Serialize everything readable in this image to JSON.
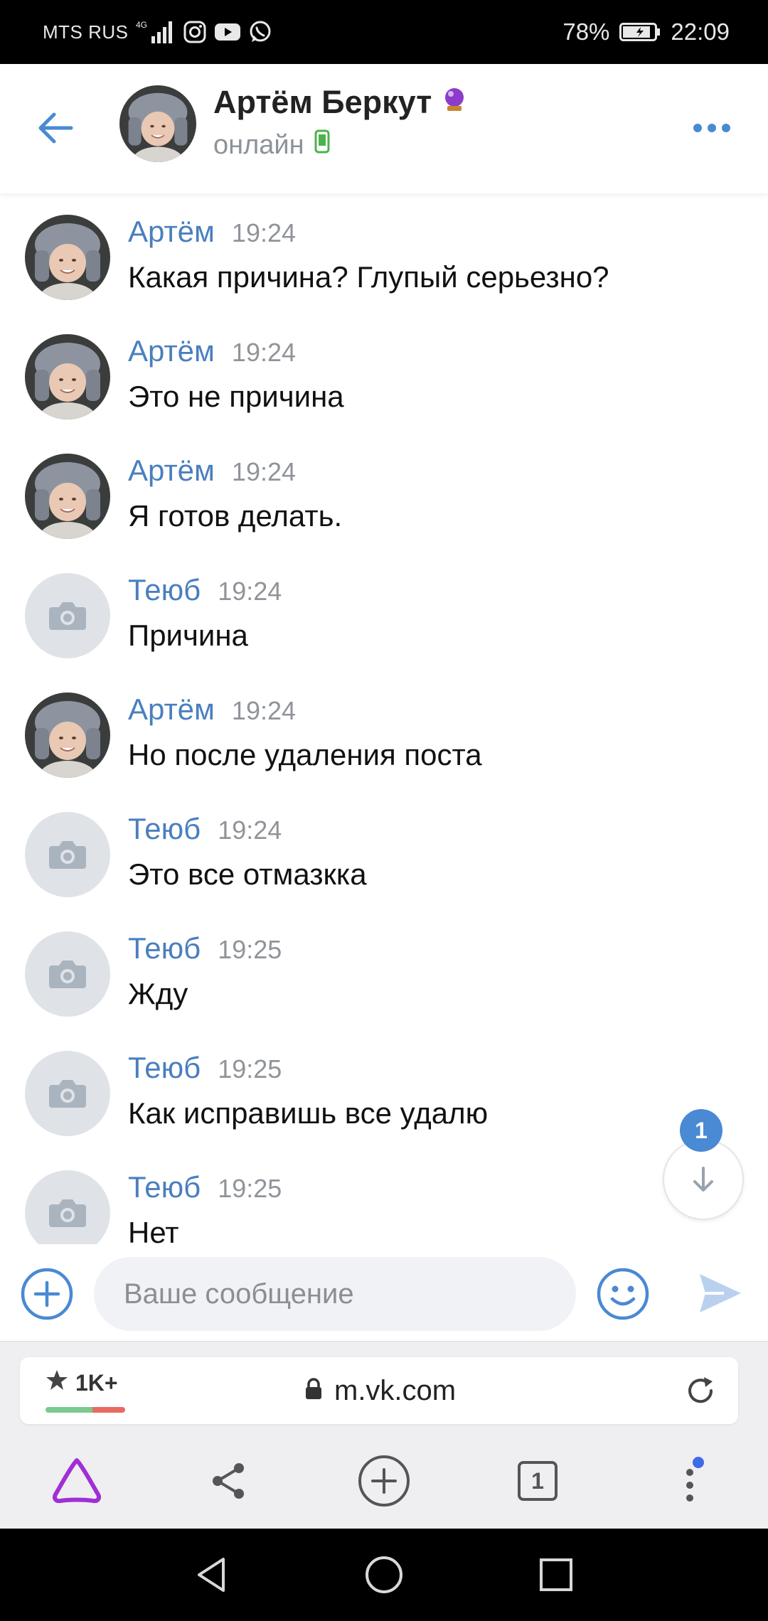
{
  "status_bar": {
    "carrier": "MTS RUS",
    "network": "4G",
    "battery": "78%",
    "time": "22:09"
  },
  "chat_header": {
    "name": "Артём Беркут",
    "status": "онлайн",
    "back_icon": "arrow-left-icon",
    "more_icon": "ellipsis-icon"
  },
  "messages": [
    {
      "author": "Артём",
      "time": "19:24",
      "text": "Какая причина? Глупый серьезно?",
      "avatar": "photo"
    },
    {
      "author": "Артём",
      "time": "19:24",
      "text": "Это не причина",
      "avatar": "photo"
    },
    {
      "author": "Артём",
      "time": "19:24",
      "text": "Я готов делать.",
      "avatar": "photo"
    },
    {
      "author": "Теюб",
      "time": "19:24",
      "text": "Причина",
      "avatar": "placeholder"
    },
    {
      "author": "Артём",
      "time": "19:24",
      "text": "Но после удаления поста",
      "avatar": "photo"
    },
    {
      "author": "Теюб",
      "time": "19:24",
      "text": "Это все отмазкка",
      "avatar": "placeholder"
    },
    {
      "author": "Теюб",
      "time": "19:25",
      "text": "Жду",
      "avatar": "placeholder"
    },
    {
      "author": "Теюб",
      "time": "19:25",
      "text": "Как исправишь все удалю",
      "avatar": "placeholder"
    },
    {
      "author": "Теюб",
      "time": "19:25",
      "text": "Нет",
      "avatar": "placeholder"
    }
  ],
  "scroll_down": {
    "badge": "1"
  },
  "composer": {
    "placeholder": "Ваше сообщение"
  },
  "browser": {
    "rating": "1K+",
    "url": "m.vk.com",
    "tabs_count": "1"
  },
  "colors": {
    "accent": "#4a7fbe",
    "badge": "#4a89d4",
    "alice": "#a02fd6",
    "rating_good": "#7bc98f",
    "rating_bad": "#e86a61"
  }
}
